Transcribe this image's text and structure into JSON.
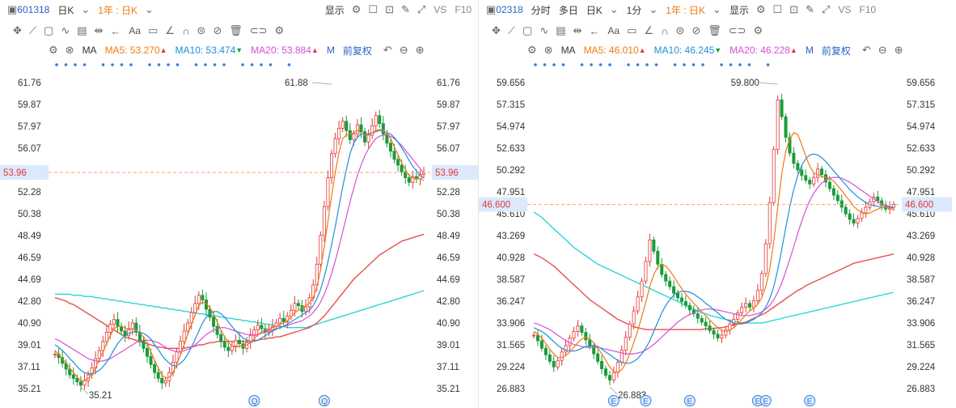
{
  "left": {
    "toolbar": {
      "code": "601318",
      "period": "日K",
      "range": "1年 : 日K",
      "display": "显示",
      "vs": "VS",
      "f10": "F10"
    },
    "drawbar_label": "Aa",
    "ma": {
      "label": "MA",
      "ma5": "MA5: 53.270",
      "ma5_dir": "▲",
      "ma10": "MA10: 53.474",
      "ma10_dir": "▼",
      "ma20": "MA20: 53.884",
      "ma20_dir": "▲",
      "more": "M",
      "adjust": "前复权"
    },
    "colors": {
      "ma5": "#f07a14",
      "ma10": "#1f8fd8",
      "ma20": "#d64fd6",
      "ma60": "#e6504a",
      "ma120": "#2ad6d6",
      "up": "#e03a3a",
      "down": "#1a9b3a"
    },
    "chart_data": {
      "type": "candlestick",
      "ticks": [
        "61.76",
        "59.87",
        "57.97",
        "56.07",
        "53.96",
        "52.28",
        "50.38",
        "48.49",
        "46.59",
        "44.69",
        "42.80",
        "40.90",
        "39.01",
        "37.11",
        "35.21"
      ],
      "ylim": [
        35.21,
        61.76
      ],
      "current": "53.96",
      "high_label": "61.88",
      "low_label": "35.21",
      "events": [
        "Q",
        "Q"
      ],
      "close": [
        38.2,
        37.9,
        37.4,
        36.9,
        36.4,
        36.1,
        35.8,
        35.5,
        35.9,
        36.4,
        37.0,
        37.8,
        38.5,
        39.3,
        40.1,
        40.8,
        41.2,
        40.6,
        40.2,
        39.8,
        40.4,
        40.9,
        40.1,
        39.4,
        38.7,
        38.0,
        37.3,
        36.6,
        36.1,
        35.7,
        35.9,
        36.6,
        37.5,
        38.4,
        39.3,
        40.2,
        40.9,
        41.8,
        42.6,
        43.3,
        42.9,
        42.1,
        41.4,
        40.6,
        39.9,
        39.3,
        38.8,
        38.5,
        38.9,
        39.4,
        39.1,
        38.7,
        39.2,
        39.8,
        40.3,
        40.7,
        40.4,
        40.1,
        40.3,
        40.6,
        40.9,
        41.3,
        41.0,
        41.5,
        42.0,
        42.6,
        42.4,
        41.9,
        42.3,
        43.1,
        44.2,
        46.0,
        48.5,
        51.0,
        53.5,
        55.6,
        56.9,
        57.8,
        58.4,
        57.6,
        56.8,
        57.3,
        58.1,
        57.5,
        56.6,
        57.2,
        58.0,
        58.9,
        58.2,
        57.3,
        56.5,
        55.8,
        55.1,
        54.6,
        54.0,
        53.5,
        53.1,
        53.6,
        53.4,
        53.8,
        53.96
      ],
      "ma5": [
        38.5,
        38.2,
        37.8,
        37.4,
        37.0,
        36.6,
        36.2,
        35.9,
        35.9,
        36.1,
        36.4,
        37.0,
        37.7,
        38.4,
        39.1,
        39.8,
        40.4,
        40.6,
        40.6,
        40.5,
        40.3,
        40.4,
        40.3,
        40.0,
        39.7,
        39.2,
        38.4,
        37.7,
        37.0,
        36.4,
        36.1,
        36.2,
        36.6,
        37.3,
        38.1,
        39.0,
        39.9,
        40.8,
        41.6,
        42.4,
        42.7,
        42.6,
        42.2,
        41.7,
        41.0,
        40.3,
        39.7,
        39.2,
        38.9,
        38.8,
        38.9,
        38.9,
        39.0,
        39.2,
        39.5,
        39.9,
        40.1,
        40.3,
        40.4,
        40.5,
        40.6,
        40.8,
        40.9,
        41.1,
        41.4,
        41.8,
        42.0,
        42.2,
        42.4,
        42.6,
        43.1,
        44.0,
        45.5,
        47.5,
        49.7,
        51.9,
        54.0,
        55.7,
        56.9,
        57.2,
        57.3,
        57.4,
        57.6,
        57.4,
        57.2,
        57.2,
        57.4,
        57.6,
        57.7,
        57.6,
        57.4,
        56.9,
        56.2,
        55.5,
        54.8,
        54.2,
        53.7,
        53.5,
        53.4,
        53.4,
        53.27
      ],
      "ma10": [
        39.0,
        38.8,
        38.5,
        38.2,
        37.8,
        37.5,
        37.1,
        36.8,
        36.6,
        36.5,
        36.5,
        36.6,
        36.8,
        37.1,
        37.5,
        38.0,
        38.6,
        39.1,
        39.5,
        39.8,
        40.0,
        40.1,
        40.2,
        40.1,
        40.0,
        39.8,
        39.5,
        39.0,
        38.6,
        38.1,
        37.7,
        37.4,
        37.2,
        37.2,
        37.4,
        37.7,
        38.2,
        38.8,
        39.5,
        40.2,
        40.9,
        41.4,
        41.7,
        41.9,
        41.9,
        41.7,
        41.4,
        41.0,
        40.6,
        40.2,
        39.9,
        39.6,
        39.4,
        39.3,
        39.3,
        39.4,
        39.6,
        39.8,
        40.0,
        40.2,
        40.4,
        40.5,
        40.6,
        40.8,
        41.0,
        41.2,
        41.4,
        41.6,
        41.8,
        42.0,
        42.4,
        43.0,
        43.8,
        44.9,
        46.2,
        47.7,
        49.3,
        51.0,
        52.7,
        54.2,
        55.6,
        56.5,
        57.0,
        57.3,
        57.3,
        57.3,
        57.4,
        57.5,
        57.6,
        57.5,
        57.4,
        57.3,
        57.0,
        56.6,
        56.1,
        55.6,
        55.0,
        54.5,
        54.1,
        53.7,
        53.47
      ],
      "ma20": [
        39.5,
        39.4,
        39.2,
        39.0,
        38.8,
        38.6,
        38.4,
        38.2,
        38.0,
        37.8,
        37.7,
        37.6,
        37.6,
        37.6,
        37.7,
        37.8,
        38.0,
        38.2,
        38.4,
        38.6,
        38.8,
        39.0,
        39.2,
        39.3,
        39.4,
        39.4,
        39.4,
        39.3,
        39.2,
        39.0,
        38.8,
        38.6,
        38.5,
        38.4,
        38.4,
        38.5,
        38.6,
        38.8,
        39.0,
        39.3,
        39.6,
        39.9,
        40.1,
        40.3,
        40.4,
        40.5,
        40.5,
        40.4,
        40.3,
        40.2,
        40.1,
        40.0,
        39.9,
        39.9,
        39.9,
        39.9,
        40.0,
        40.1,
        40.2,
        40.3,
        40.4,
        40.5,
        40.6,
        40.7,
        40.8,
        40.9,
        41.0,
        41.1,
        41.3,
        41.5,
        41.8,
        42.2,
        42.7,
        43.4,
        44.2,
        45.2,
        46.3,
        47.5,
        48.8,
        50.1,
        51.4,
        52.6,
        53.7,
        54.6,
        55.4,
        56.0,
        56.5,
        56.9,
        57.1,
        57.2,
        57.2,
        57.1,
        56.9,
        56.6,
        56.3,
        55.9,
        55.5,
        55.1,
        54.7,
        54.3,
        53.88
      ],
      "ma60": [
        43.1,
        43.0,
        42.9,
        42.8,
        42.6,
        42.5,
        42.3,
        42.1,
        41.9,
        41.7,
        41.5,
        41.3,
        41.1,
        40.9,
        40.7,
        40.5,
        40.3,
        40.1,
        39.9,
        39.7,
        39.6,
        39.5,
        39.4,
        39.3,
        39.2,
        39.1,
        39.0,
        38.9,
        38.8,
        38.8,
        38.7,
        38.7,
        38.7,
        38.7,
        38.7,
        38.7,
        38.8,
        38.8,
        38.9,
        39.0,
        39.0,
        39.1,
        39.2,
        39.2,
        39.3,
        39.3,
        39.3,
        39.3,
        39.3,
        39.3,
        39.3,
        39.3,
        39.3,
        39.4,
        39.4,
        39.4,
        39.5,
        39.5,
        39.6,
        39.6,
        39.7,
        39.7,
        39.8,
        39.9,
        40.0,
        40.1,
        40.2,
        40.3,
        40.4,
        40.5,
        40.7,
        40.9,
        41.2,
        41.5,
        41.9,
        42.3,
        42.7,
        43.1,
        43.5,
        43.9,
        44.3,
        44.7,
        45.0,
        45.3,
        45.6,
        45.9,
        46.2,
        46.5,
        46.8,
        47.0,
        47.2,
        47.4,
        47.6,
        47.8,
        48.0,
        48.1,
        48.2,
        48.3,
        48.4,
        48.5,
        48.6
      ],
      "ma120": [
        43.4,
        43.4,
        43.4,
        43.4,
        43.4,
        43.3,
        43.3,
        43.3,
        43.2,
        43.2,
        43.2,
        43.1,
        43.1,
        43.0,
        43.0,
        42.9,
        42.9,
        42.8,
        42.8,
        42.7,
        42.7,
        42.6,
        42.6,
        42.5,
        42.5,
        42.4,
        42.4,
        42.3,
        42.3,
        42.2,
        42.2,
        42.1,
        42.1,
        42.0,
        42.0,
        41.9,
        41.9,
        41.8,
        41.8,
        41.7,
        41.7,
        41.6,
        41.6,
        41.5,
        41.5,
        41.4,
        41.4,
        41.3,
        41.3,
        41.2,
        41.2,
        41.1,
        41.1,
        41.0,
        41.0,
        40.9,
        40.9,
        40.8,
        40.8,
        40.7,
        40.7,
        40.6,
        40.6,
        40.5,
        40.5,
        40.5,
        40.5,
        40.5,
        40.5,
        40.6,
        40.7,
        40.8,
        40.9,
        41.0,
        41.1,
        41.2,
        41.3,
        41.4,
        41.5,
        41.6,
        41.7,
        41.8,
        41.9,
        42.0,
        42.1,
        42.2,
        42.3,
        42.4,
        42.5,
        42.6,
        42.7,
        42.8,
        42.9,
        43.0,
        43.1,
        43.2,
        43.3,
        43.4,
        43.5,
        43.6,
        43.7
      ]
    }
  },
  "right": {
    "toolbar": {
      "code": "02318",
      "t1": "分时",
      "t2": "多日",
      "period": "日K",
      "minute": "1分",
      "range": "1年 : 日K",
      "display": "显示",
      "vs": "VS",
      "f10": "F10"
    },
    "drawbar_label": "Aa",
    "ma": {
      "label": "MA",
      "ma5": "MA5: 46.010",
      "ma5_dir": "▲",
      "ma10": "MA10: 46.245",
      "ma10_dir": "▼",
      "ma20": "MA20: 46.228",
      "ma20_dir": "▲",
      "more": "M",
      "adjust": "前复权"
    },
    "colors": {
      "ma5": "#f07a14",
      "ma10": "#1f8fd8",
      "ma20": "#d64fd6",
      "ma60": "#e6504a",
      "ma120": "#2ad6d6",
      "up": "#e03a3a",
      "down": "#1a9b3a"
    },
    "chart_data": {
      "type": "candlestick",
      "ticks": [
        "59.656",
        "57.315",
        "54.974",
        "52.633",
        "50.292",
        "47.951",
        "45.610",
        "43.269",
        "40.928",
        "38.587",
        "36.247",
        "33.906",
        "31.565",
        "29.224",
        "26.883"
      ],
      "ylim": [
        26.883,
        59.656
      ],
      "current": "46.600",
      "high_label": "59.800",
      "low_label": "26.883",
      "events": [
        "E",
        "E",
        "E",
        "E",
        "E",
        "E"
      ],
      "close": [
        32.6,
        32.0,
        31.2,
        30.5,
        29.8,
        29.2,
        29.9,
        30.8,
        31.5,
        32.3,
        33.0,
        33.6,
        32.9,
        32.1,
        31.4,
        30.6,
        29.8,
        29.0,
        28.3,
        27.8,
        28.6,
        29.7,
        31.0,
        32.4,
        33.8,
        35.2,
        36.7,
        38.4,
        40.5,
        42.8,
        41.6,
        40.2,
        39.1,
        38.4,
        37.8,
        37.1,
        36.6,
        36.2,
        35.8,
        35.3,
        34.9,
        34.4,
        34.0,
        33.6,
        33.1,
        32.7,
        32.3,
        32.6,
        33.2,
        33.8,
        34.3,
        35.0,
        35.6,
        36.0,
        35.6,
        36.3,
        37.4,
        39.2,
        42.4,
        46.8,
        52.5,
        57.8,
        56.0,
        53.8,
        52.1,
        51.0,
        50.3,
        49.7,
        49.2,
        48.8,
        49.5,
        50.4,
        49.8,
        49.0,
        48.3,
        47.6,
        47.0,
        46.3,
        45.6,
        45.0,
        44.6,
        45.1,
        45.7,
        46.3,
        46.9,
        47.4,
        47.0,
        46.5,
        46.1,
        46.3,
        46.6
      ],
      "ma5": [
        33.0,
        32.7,
        32.3,
        31.7,
        31.1,
        30.6,
        30.2,
        30.2,
        30.4,
        30.8,
        31.3,
        31.8,
        32.2,
        32.4,
        32.2,
        31.8,
        31.2,
        30.6,
        29.9,
        29.2,
        28.7,
        28.6,
        28.9,
        29.6,
        30.6,
        31.8,
        33.1,
        34.6,
        36.1,
        37.8,
        39.1,
        39.9,
        40.2,
        40.0,
        39.5,
        38.9,
        38.2,
        37.6,
        37.0,
        36.5,
        36.0,
        35.6,
        35.1,
        34.7,
        34.2,
        33.8,
        33.4,
        33.1,
        33.0,
        33.1,
        33.4,
        33.8,
        34.3,
        34.8,
        35.2,
        35.5,
        35.9,
        36.6,
        37.8,
        39.7,
        42.6,
        46.3,
        49.9,
        52.3,
        53.6,
        54.3,
        54.1,
        53.0,
        51.8,
        50.7,
        50.0,
        49.8,
        49.6,
        49.5,
        49.4,
        49.1,
        48.6,
        48.1,
        47.5,
        47.0,
        46.4,
        46.0,
        45.8,
        45.6,
        45.7,
        45.9,
        46.1,
        46.3,
        46.3,
        46.2,
        46.01
      ],
      "ma10": [
        33.4,
        33.2,
        33.0,
        32.7,
        32.3,
        31.9,
        31.5,
        31.2,
        31.0,
        30.9,
        30.9,
        31.0,
        31.2,
        31.4,
        31.5,
        31.5,
        31.4,
        31.1,
        30.8,
        30.5,
        30.2,
        29.9,
        29.7,
        29.6,
        29.6,
        29.8,
        30.1,
        30.6,
        31.2,
        32.0,
        33.0,
        34.0,
        35.0,
        35.8,
        36.4,
        36.9,
        37.2,
        37.3,
        37.3,
        37.2,
        37.0,
        36.7,
        36.4,
        36.0,
        35.7,
        35.3,
        35.0,
        34.6,
        34.3,
        34.1,
        33.9,
        33.8,
        33.8,
        33.9,
        34.1,
        34.3,
        34.6,
        35.0,
        35.6,
        36.5,
        37.8,
        39.6,
        41.8,
        44.1,
        46.3,
        48.2,
        49.7,
        50.8,
        51.5,
        51.9,
        52.0,
        51.9,
        51.6,
        51.2,
        50.7,
        50.2,
        49.7,
        49.2,
        48.7,
        48.2,
        47.8,
        47.4,
        47.1,
        46.8,
        46.6,
        46.5,
        46.4,
        46.3,
        46.3,
        46.3,
        46.25
      ],
      "ma20": [
        33.9,
        33.8,
        33.6,
        33.4,
        33.2,
        32.9,
        32.6,
        32.3,
        32.0,
        31.8,
        31.6,
        31.5,
        31.4,
        31.3,
        31.3,
        31.3,
        31.3,
        31.2,
        31.1,
        31.0,
        30.9,
        30.8,
        30.7,
        30.6,
        30.6,
        30.6,
        30.7,
        30.8,
        31.0,
        31.3,
        31.6,
        32.0,
        32.4,
        32.8,
        33.2,
        33.6,
        34.0,
        34.3,
        34.6,
        34.8,
        35.0,
        35.2,
        35.3,
        35.4,
        35.4,
        35.4,
        35.3,
        35.2,
        35.1,
        35.0,
        34.9,
        34.8,
        34.7,
        34.7,
        34.7,
        34.8,
        34.9,
        35.1,
        35.4,
        35.8,
        36.4,
        37.2,
        38.2,
        39.4,
        40.7,
        42.1,
        43.5,
        44.8,
        46.0,
        47.0,
        47.8,
        48.4,
        48.9,
        49.2,
        49.4,
        49.5,
        49.5,
        49.4,
        49.2,
        49.0,
        48.7,
        48.4,
        48.1,
        47.8,
        47.5,
        47.2,
        46.9,
        46.7,
        46.5,
        46.4,
        46.23
      ],
      "ma60": [
        41.3,
        41.1,
        40.9,
        40.6,
        40.3,
        40.0,
        39.6,
        39.2,
        38.8,
        38.4,
        38.0,
        37.6,
        37.2,
        36.8,
        36.4,
        36.1,
        35.8,
        35.5,
        35.2,
        34.9,
        34.6,
        34.3,
        34.1,
        33.9,
        33.7,
        33.5,
        33.4,
        33.3,
        33.2,
        33.2,
        33.2,
        33.2,
        33.2,
        33.2,
        33.2,
        33.2,
        33.2,
        33.2,
        33.2,
        33.2,
        33.2,
        33.2,
        33.2,
        33.3,
        33.3,
        33.3,
        33.4,
        33.4,
        33.5,
        33.6,
        33.7,
        33.8,
        33.9,
        34.0,
        34.2,
        34.4,
        34.6,
        34.8,
        35.0,
        35.3,
        35.6,
        35.9,
        36.2,
        36.5,
        36.8,
        37.1,
        37.4,
        37.6,
        37.9,
        38.1,
        38.3,
        38.5,
        38.7,
        38.9,
        39.1,
        39.3,
        39.5,
        39.7,
        39.9,
        40.1,
        40.3,
        40.4,
        40.5,
        40.6,
        40.7,
        40.8,
        40.9,
        41.0,
        41.1,
        41.2,
        41.3
      ],
      "ma120": [
        45.8,
        45.5,
        45.2,
        44.8,
        44.4,
        44.0,
        43.6,
        43.2,
        42.8,
        42.4,
        42.0,
        41.7,
        41.4,
        41.1,
        40.8,
        40.5,
        40.2,
        40.0,
        39.8,
        39.6,
        39.4,
        39.2,
        39.0,
        38.8,
        38.6,
        38.4,
        38.2,
        38.0,
        37.8,
        37.6,
        37.4,
        37.2,
        37.0,
        36.8,
        36.6,
        36.4,
        36.2,
        36.0,
        35.8,
        35.6,
        35.4,
        35.2,
        35.0,
        34.9,
        34.7,
        34.6,
        34.5,
        34.4,
        34.3,
        34.2,
        34.1,
        34.0,
        33.9,
        33.9,
        33.9,
        33.9,
        33.9,
        33.9,
        34.0,
        34.1,
        34.2,
        34.3,
        34.4,
        34.5,
        34.6,
        34.7,
        34.8,
        34.9,
        35.0,
        35.1,
        35.2,
        35.3,
        35.4,
        35.5,
        35.6,
        35.7,
        35.8,
        35.9,
        36.0,
        36.1,
        36.2,
        36.3,
        36.4,
        36.5,
        36.6,
        36.7,
        36.8,
        36.9,
        37.0,
        37.1,
        37.2
      ]
    }
  }
}
